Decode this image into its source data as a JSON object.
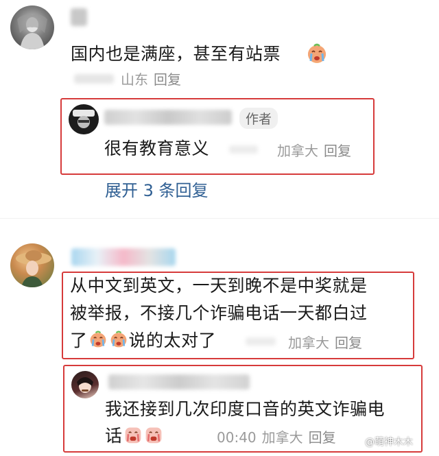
{
  "comment1": {
    "text": "国内也是满座，甚至有站票",
    "location": "山东",
    "reply_label": "回复",
    "expand_label": "展开 3 条回复",
    "reply": {
      "author_tag": "作者",
      "text": "很有教育意义",
      "location": "加拿大",
      "reply_label": "回复"
    }
  },
  "comment2": {
    "text_line1": "从中文到英文，一天到晚不是中奖就是",
    "text_line2": "被举报，不接几个诈骗电话一天都白过",
    "text_line3_prefix": "了",
    "text_line3_suffix": "说的太对了",
    "location": "加拿大",
    "reply_label": "回复",
    "reply": {
      "text_line1": "我还接到几次印度口音的英文诈骗电",
      "text_line2_prefix": "话",
      "time": "00:40",
      "location": "加拿大",
      "reply_label": "回复"
    }
  },
  "watermark": "@萌神木木",
  "icons": {
    "crying_emoji": "crying-face-emoji",
    "author_avatar": "avatar"
  },
  "colors": {
    "highlight_box": "#d63a3a",
    "link_blue": "#2f5f93",
    "meta_gray": "#9a9a9a"
  }
}
